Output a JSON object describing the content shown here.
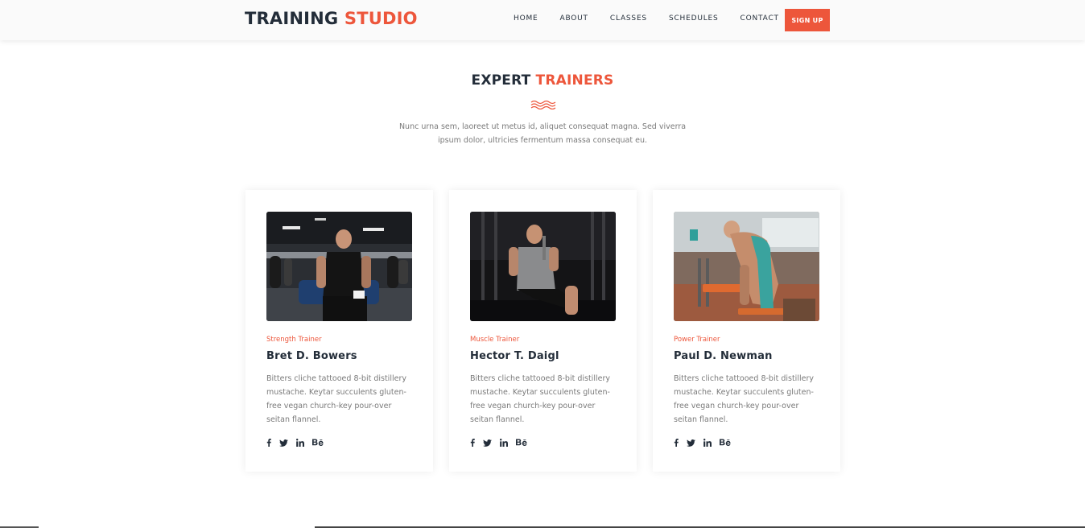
{
  "header": {
    "logo_primary": "TRAINING",
    "logo_accent": "STUDIO",
    "nav": [
      "HOME",
      "ABOUT",
      "CLASSES",
      "SCHEDULES",
      "CONTACT"
    ],
    "signup_label": "SIGN UP"
  },
  "section": {
    "title_primary": "EXPERT",
    "title_accent": "TRAINERS",
    "description": "Nunc urna sem, laoreet ut metus id, aliquet consequat magna. Sed viverra ipsum dolor, ultricies fermentum massa consequat eu."
  },
  "trainers": [
    {
      "role": "Strength Trainer",
      "name": "Bret D. Bowers",
      "bio": "Bitters cliche tattooed 8-bit distillery mustache. Keytar succulents gluten-free vegan church-key pour-over seitan flannel."
    },
    {
      "role": "Muscle Trainer",
      "name": "Hector T. Daigl",
      "bio": "Bitters cliche tattooed 8-bit distillery mustache. Keytar succulents gluten-free vegan church-key pour-over seitan flannel."
    },
    {
      "role": "Power Trainer",
      "name": "Paul D. Newman",
      "bio": "Bitters cliche tattooed 8-bit distillery mustache. Keytar succulents gluten-free vegan church-key pour-over seitan flannel."
    }
  ],
  "social_icons": [
    "facebook-icon",
    "twitter-icon",
    "linkedin-icon",
    "behance-icon"
  ],
  "colors": {
    "accent": "#ed563b",
    "dark": "#232d39",
    "body_text": "#7a7a7a"
  }
}
